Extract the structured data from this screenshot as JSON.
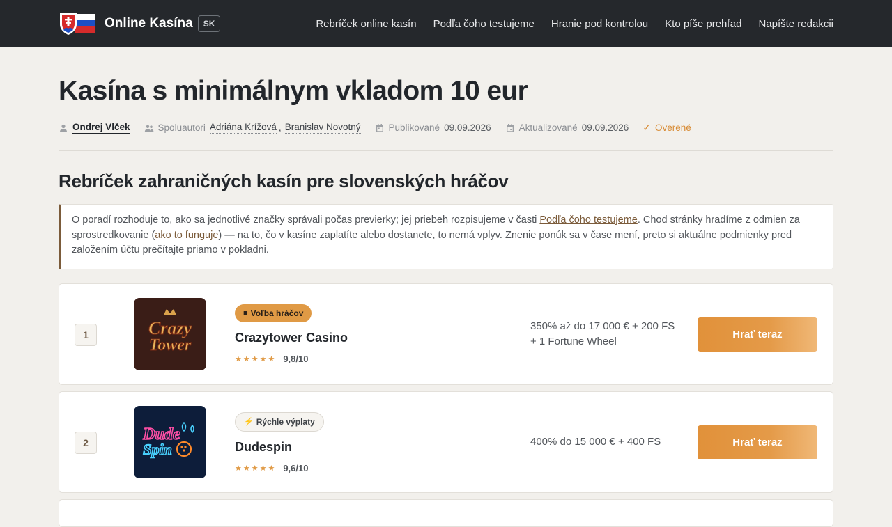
{
  "header": {
    "brand": "Online Kasína",
    "brand_badge": "SK",
    "nav": [
      "Rebríček online kasín",
      "Podľa čoho testujeme",
      "Hranie pod kontrolou",
      "Kto píše prehľad",
      "Napíšte redakcii"
    ]
  },
  "page": {
    "title": "Kasína s minimálnym vkladom 10 eur",
    "meta": {
      "author": "Ondrej Vlček",
      "coauthors_label": "Spoluautori",
      "coauthors": [
        "Adriána Krížová",
        "Branislav Novotný"
      ],
      "coauthor_sep": ",",
      "published_label": "Publikované",
      "published": "09.09.2026",
      "updated_label": "Aktualizované",
      "updated": "09.09.2026",
      "verified": "Overené"
    },
    "section_title": "Rebríček zahraničných kasín pre slovenských hráčov",
    "notice": {
      "p1": "O poradí rozhoduje to, ako sa jednotlivé značky správali počas previerky; jej priebeh rozpisujeme v časti ",
      "link1": "Podľa čoho testujeme",
      "p2": ". Chod stránky hradíme z odmien za sprostredkovanie (",
      "link2": "ako to funguje",
      "p3": ") — na to, čo v kasíne zaplatíte alebo dostanete, to nemá vplyv. Znenie ponúk sa v čase mení, preto si aktuálne podmienky pred založením účtu prečítajte priamo v pokladni."
    }
  },
  "casinos": [
    {
      "rank": "1",
      "badge": "Voľba hráčov",
      "badge_icon": "■",
      "name": "Crazytower Casino",
      "logo_line1": "Crazy",
      "logo_line2": "Tower",
      "stars": "★★★★★",
      "score": "9,8/10",
      "bonus_line1": "350% až do 17 000 € + 200 FS",
      "bonus_line2": "+ 1 Fortune Wheel",
      "cta": "Hrať teraz"
    },
    {
      "rank": "2",
      "badge": "Rýchle výplaty",
      "badge_icon": "⚡",
      "name": "Dudespin",
      "logo_line1": "Dude",
      "logo_line2": "Spin",
      "stars": "★★★★★",
      "score": "9,6/10",
      "bonus_line1": "400% do 15 000 € + 400 FS",
      "bonus_line2": "",
      "cta": "Hrať teraz"
    }
  ],
  "colors": {
    "header_bg": "#25282c",
    "page_bg": "#f2f0ec",
    "accent": "#e09a45",
    "link": "#7b5b3a"
  }
}
